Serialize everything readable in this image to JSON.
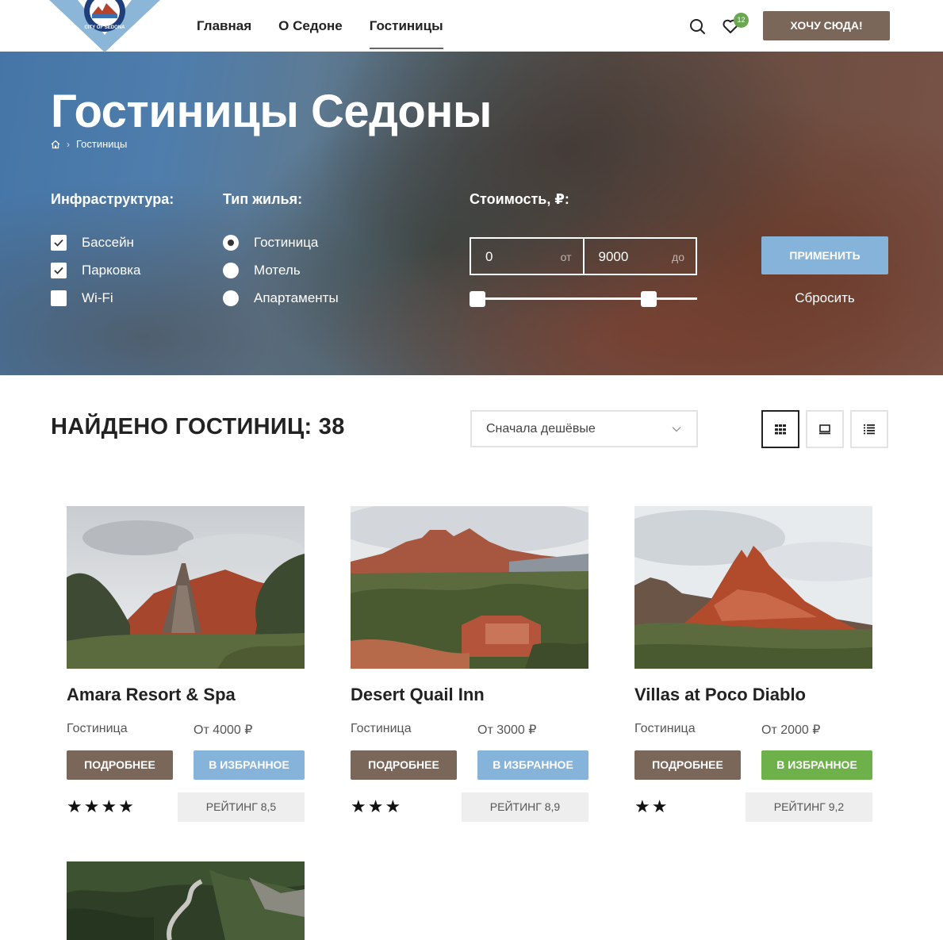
{
  "header": {
    "logo_text": "CITY OF SEDONA",
    "nav": [
      {
        "label": "Главная"
      },
      {
        "label": "О Седоне"
      },
      {
        "label": "Гостиницы"
      }
    ],
    "favorites_count": "12",
    "cta_label": "ХОЧУ СЮДА!"
  },
  "hero": {
    "title": "Гостиницы Седоны",
    "breadcrumb_current": "Гостиницы",
    "infrastructure": {
      "label": "Инфраструктура:",
      "options": [
        {
          "label": "Бассейн",
          "checked": true
        },
        {
          "label": "Парковка",
          "checked": true
        },
        {
          "label": "Wi-Fi",
          "checked": false
        }
      ]
    },
    "housing": {
      "label": "Тип жилья:",
      "options": [
        {
          "label": "Гостиница",
          "selected": true
        },
        {
          "label": "Мотель",
          "selected": false
        },
        {
          "label": "Апартаменты",
          "selected": false
        }
      ]
    },
    "price": {
      "label": "Стоимость, ₽:",
      "from_value": "0",
      "from_suffix": "от",
      "to_value": "9000",
      "to_suffix": "до"
    },
    "apply_label": "ПРИМЕНИТЬ",
    "reset_label": "Сбросить"
  },
  "results": {
    "found_label": "НАЙДЕНО ГОСТИНИЦ: 38",
    "sort_value": "Сначала дешёвые",
    "view_modes": [
      "grid",
      "card",
      "list"
    ],
    "active_view": "grid"
  },
  "hotels": [
    {
      "name": "Amara Resort & Spa",
      "type": "Гостиница",
      "price": "От 4000 ₽",
      "more_label": "ПОДРОБНЕЕ",
      "fav_label": "В ИЗБРАННОЕ",
      "stars": "★★★★",
      "rating": "РЕЙТИНГ 8,5",
      "fav_color": "#86b3d9"
    },
    {
      "name": "Desert Quail Inn",
      "type": "Гостиница",
      "price": "От 3000 ₽",
      "more_label": "ПОДРОБНЕЕ",
      "fav_label": "В ИЗБРАННОЕ",
      "stars": "★★★",
      "rating": "РЕЙТИНГ 8,9",
      "fav_color": "#86b3d9"
    },
    {
      "name": "Villas at Poco Diablo",
      "type": "Гостиница",
      "price": "От 2000 ₽",
      "more_label": "ПОДРОБНЕЕ",
      "fav_label": "В ИЗБРАННОЕ",
      "stars": "★★",
      "rating": "РЕЙТИНГ 9,2",
      "fav_color": "#6eb04a"
    }
  ],
  "colors": {
    "brown": "#7b6759",
    "light_blue": "#86b3d9",
    "green": "#6eb04a",
    "badge_green": "#6aa84f"
  }
}
